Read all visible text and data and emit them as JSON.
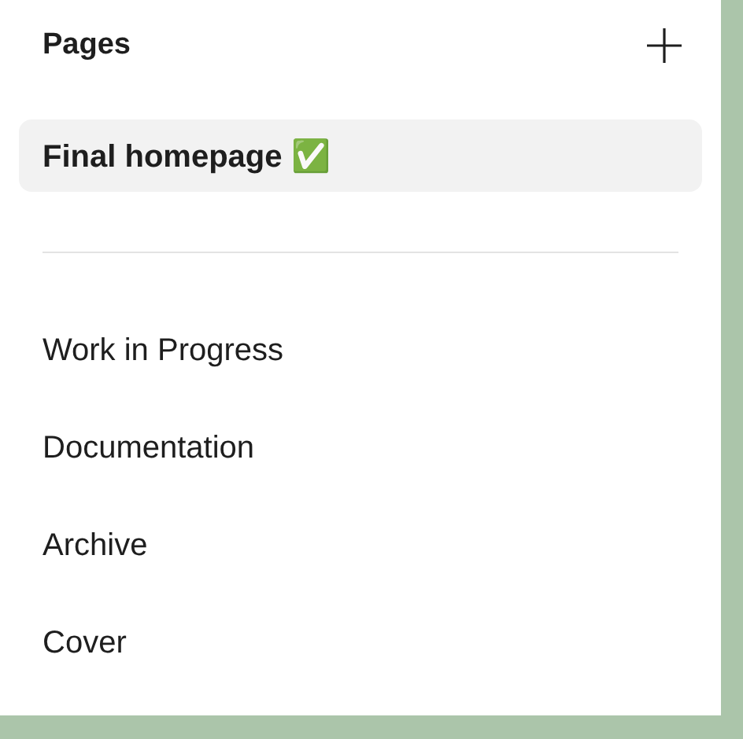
{
  "header": {
    "title": "Pages"
  },
  "top_pages": [
    {
      "label": "Final homepage ✅",
      "selected": true
    }
  ],
  "pages": [
    {
      "label": "Work in Progress",
      "selected": false
    },
    {
      "label": "Documentation",
      "selected": false
    },
    {
      "label": "Archive",
      "selected": false
    },
    {
      "label": "Cover",
      "selected": false
    }
  ]
}
